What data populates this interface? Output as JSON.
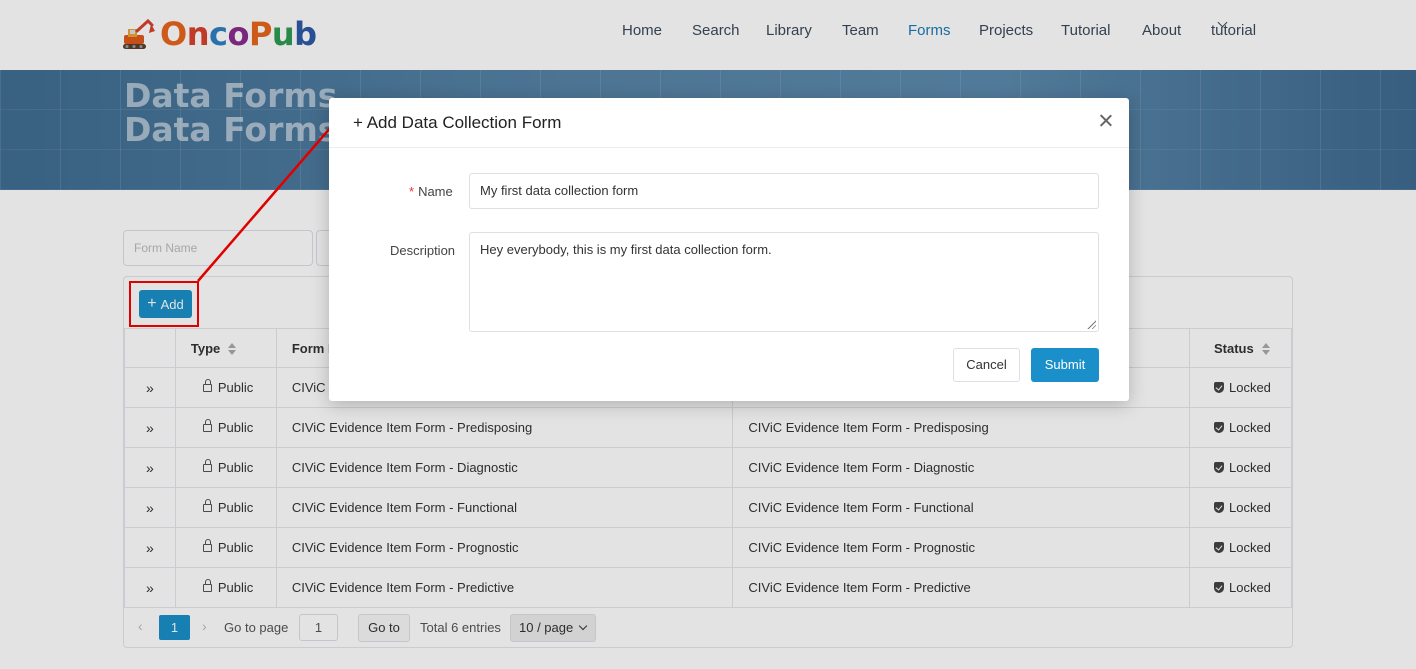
{
  "brand": {
    "name_parts": [
      "O",
      "n",
      "c",
      "o",
      "P",
      "u",
      "b"
    ],
    "logo_icon": "excavator-icon"
  },
  "nav": {
    "items": [
      {
        "label": "Home"
      },
      {
        "label": "Search"
      },
      {
        "label": "Library"
      },
      {
        "label": "Team"
      },
      {
        "label": "Forms",
        "active": true
      },
      {
        "label": "Projects"
      },
      {
        "label": "Tutorial"
      },
      {
        "label": "About"
      }
    ],
    "user": "tutorial"
  },
  "hero": {
    "title": "Data Forms"
  },
  "filters": {
    "form_name_placeholder": "Form Name"
  },
  "toolbar": {
    "add_label": "Add"
  },
  "table": {
    "headers": {
      "type": "Type",
      "form_name": "Form N",
      "status": "Status"
    },
    "rows": [
      {
        "expand": "»",
        "type": "Public",
        "name": "CIViC E",
        "description": "",
        "status": "Locked"
      },
      {
        "expand": "»",
        "type": "Public",
        "name": "CIViC Evidence Item Form - Predisposing",
        "description": "CIViC Evidence Item Form - Predisposing",
        "status": "Locked"
      },
      {
        "expand": "»",
        "type": "Public",
        "name": "CIViC Evidence Item Form - Diagnostic",
        "description": "CIViC Evidence Item Form - Diagnostic",
        "status": "Locked"
      },
      {
        "expand": "»",
        "type": "Public",
        "name": "CIViC Evidence Item Form - Functional",
        "description": "CIViC Evidence Item Form - Functional",
        "status": "Locked"
      },
      {
        "expand": "»",
        "type": "Public",
        "name": "CIViC Evidence Item Form - Prognostic",
        "description": "CIViC Evidence Item Form - Prognostic",
        "status": "Locked"
      },
      {
        "expand": "»",
        "type": "Public",
        "name": "CIViC Evidence Item Form - Predictive",
        "description": "CIViC Evidence Item Form - Predictive",
        "status": "Locked"
      }
    ]
  },
  "pagination": {
    "current_page": "1",
    "goto_label": "Go to page",
    "goto_value": "1",
    "goto_button": "Go to",
    "total": "Total 6 entries",
    "per_page": "10 / page"
  },
  "modal": {
    "title": "+ Add Data Collection Form",
    "name_label": "Name",
    "required_marker": "*",
    "name_value": "My first data collection form",
    "description_label": "Description",
    "description_value": "Hey everybody, this is my first data collection form.",
    "cancel_label": "Cancel",
    "submit_label": "Submit"
  },
  "colors": {
    "accent": "#1b8fc9",
    "annotation": "#e00000",
    "nav_active": "#1b7bb8"
  }
}
